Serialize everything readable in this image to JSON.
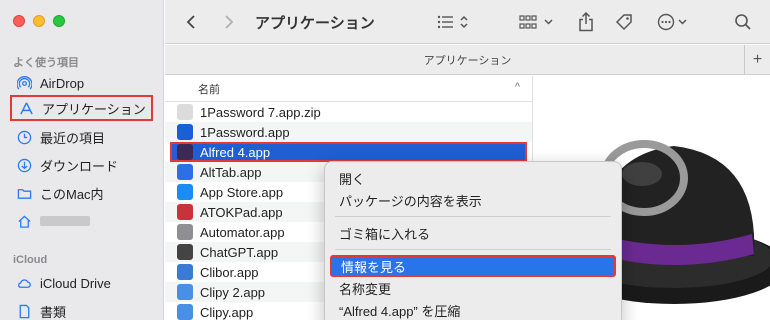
{
  "window": {
    "title": "アプリケーション"
  },
  "sidebar": {
    "favorites_heading": "よく使う項目",
    "favorites": [
      {
        "label": "AirDrop",
        "icon": "airdrop-icon"
      },
      {
        "label": "アプリケーション",
        "icon": "applications-icon",
        "selected": true
      },
      {
        "label": "最近の項目",
        "icon": "clock-icon"
      },
      {
        "label": "ダウンロード",
        "icon": "download-icon"
      },
      {
        "label": "このMac内",
        "icon": "folder-icon"
      },
      {
        "label": "",
        "icon": "home-icon"
      }
    ],
    "icloud_heading": "iCloud",
    "icloud": [
      {
        "label": "iCloud Drive",
        "icon": "cloud-icon"
      },
      {
        "label": "書類",
        "icon": "document-icon"
      }
    ]
  },
  "toolbar": {
    "title": "アプリケーション"
  },
  "pathbar": {
    "label": "アプリケーション"
  },
  "column": {
    "header": "名前",
    "files": [
      {
        "name": "1Password 7.app.zip",
        "color": "#dcdcdc"
      },
      {
        "name": "1Password.app",
        "color": "#1b5fd6"
      },
      {
        "name": "Alfred 4.app",
        "color": "#3a2a55",
        "selected": true
      },
      {
        "name": "AltTab.app",
        "color": "#2c6fe6"
      },
      {
        "name": "App Store.app",
        "color": "#1b8cf3"
      },
      {
        "name": "ATOKPad.app",
        "color": "#c8323a"
      },
      {
        "name": "Automator.app",
        "color": "#8e8e93"
      },
      {
        "name": "ChatGPT.app",
        "color": "#444444"
      },
      {
        "name": "Clibor.app",
        "color": "#3a7bd5"
      },
      {
        "name": "Clipy 2.app",
        "color": "#4a90e2"
      },
      {
        "name": "Clipy.app",
        "color": "#4a90e2"
      }
    ]
  },
  "context_menu": {
    "items": [
      {
        "label": "開く"
      },
      {
        "label": "パッケージの内容を表示"
      },
      {
        "sep": true
      },
      {
        "label": "ゴミ箱に入れる"
      },
      {
        "sep": true
      },
      {
        "label": "情報を見る",
        "highlighted": true
      },
      {
        "label": "名称変更"
      },
      {
        "label": "“Alfred 4.app” を圧縮"
      }
    ]
  }
}
